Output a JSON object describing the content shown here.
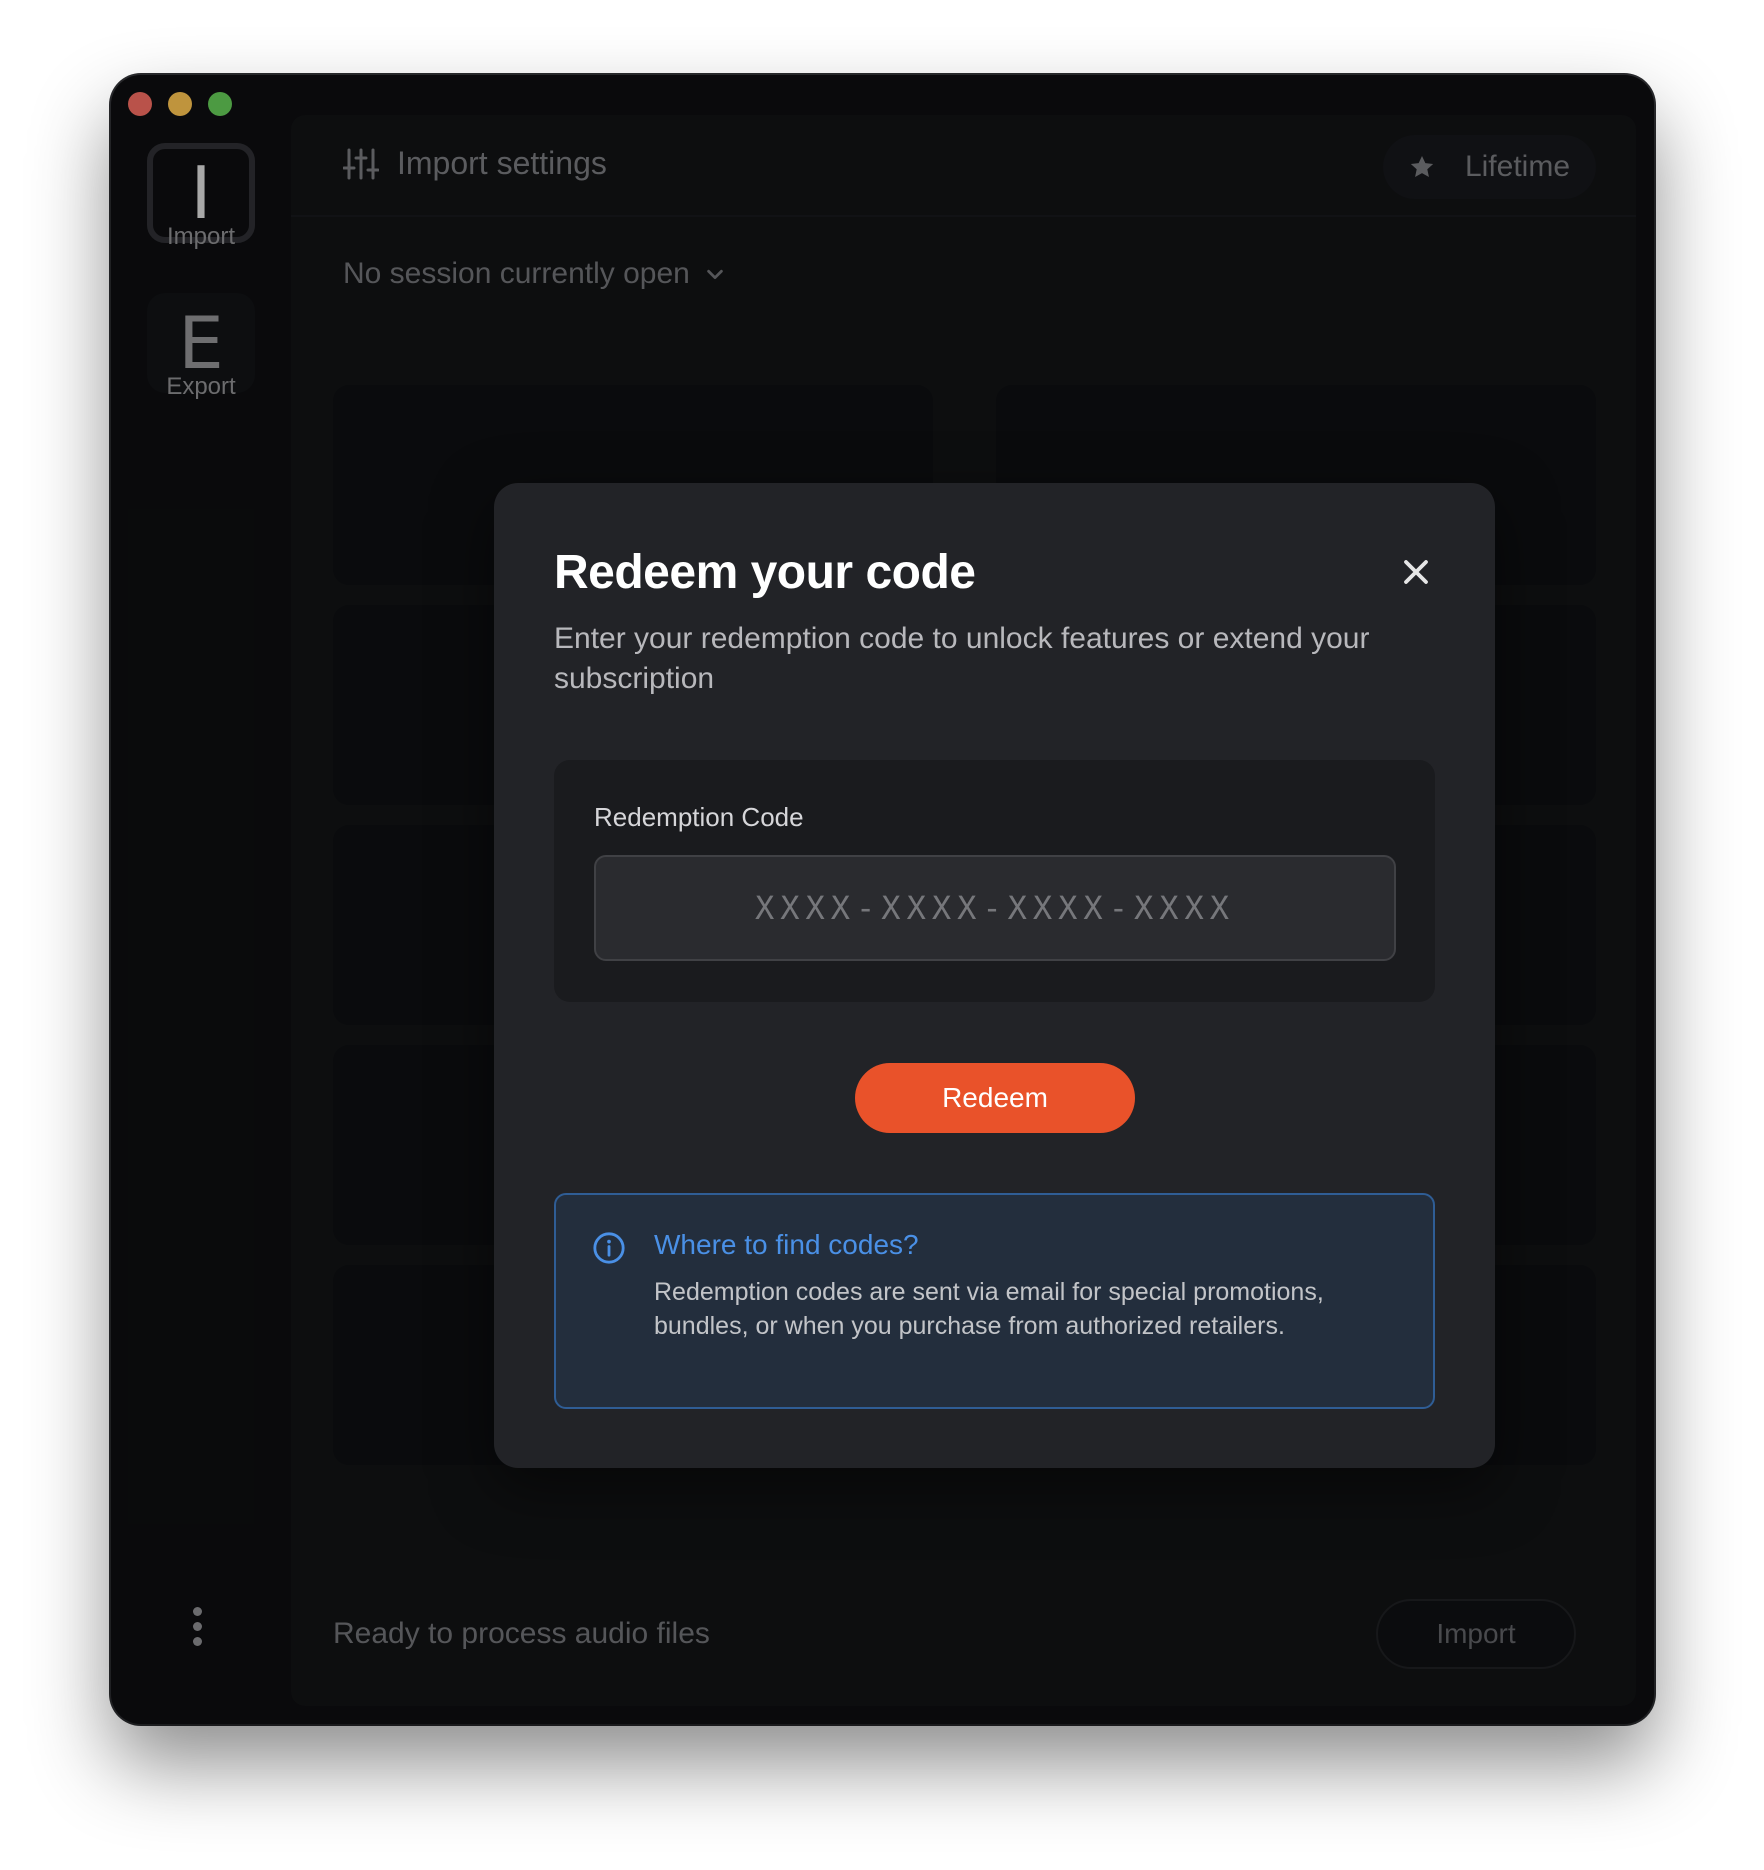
{
  "sidebar": {
    "import_icon_letter": "I",
    "import_label": "Import",
    "export_icon_letter": "E",
    "export_label": "Export"
  },
  "topbar": {
    "title": "Import settings",
    "plan_label": "Lifetime"
  },
  "session": {
    "label": "No session currently open"
  },
  "footer": {
    "status": "Ready to process audio files",
    "import_button": "Import"
  },
  "modal": {
    "title": "Redeem your code",
    "subtitle": "Enter your redemption code to unlock features or extend your subscription",
    "field_label": "Redemption Code",
    "field_value": "",
    "field_placeholder": "XXXX-XXXX-XXXX-XXXX",
    "redeem_button": "Redeem",
    "info_title": "Where to find codes?",
    "info_text": "Redemption codes are sent via email for special promotions, bundles, or when you purchase from authorized retailers."
  },
  "colors": {
    "accent": "#e9522a",
    "info_blue": "#4a90e6",
    "traffic_red": "#ee6a5f",
    "traffic_yellow": "#f5be4f",
    "traffic_green": "#62c655"
  }
}
